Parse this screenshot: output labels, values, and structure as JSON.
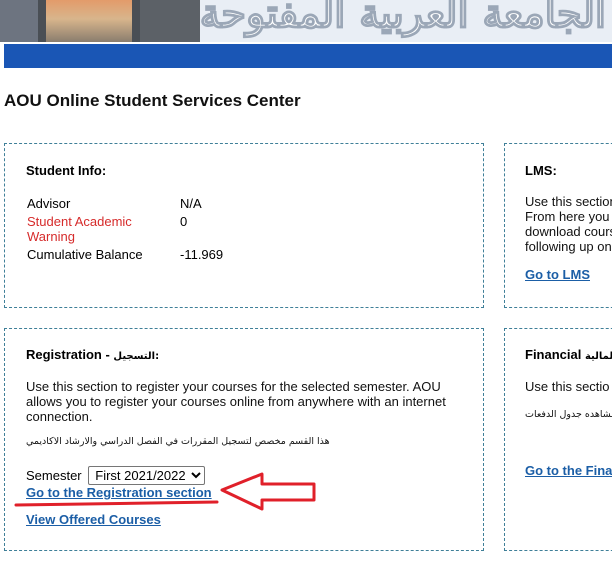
{
  "header": {
    "arabic_title": "الجامعة العربية المفتوحة"
  },
  "page_title": "AOU Online Student Services Center",
  "student_info": {
    "title": "Student Info:",
    "rows": [
      {
        "label": "Advisor",
        "value": "N/A"
      },
      {
        "label": "Student Academic Warning",
        "value": "0"
      },
      {
        "label": "Cumulative Balance",
        "value": "-11.969"
      }
    ]
  },
  "lms": {
    "title": "LMS:",
    "text": "Use this section From here you download cours following up on",
    "link": "Go to LMS"
  },
  "registration": {
    "title": "Registration - ",
    "title_ar": "التسجيل:",
    "text": "Use this section to register your courses for the selected semester. AOU allows you to register your courses online from anywhere with an internet connection.",
    "text_ar": "هذا القسم مخصص لتسجيل المقررات في الفصل الدراسي والارشاد الاكاديمي",
    "semester_label": "Semester",
    "semester_selected": "First 2021/2022",
    "link_registration": "Go to the Registration section",
    "link_offered": "View Offered Courses"
  },
  "financial": {
    "title": "Financial",
    "title_ar": "المالية -",
    "text": "Use this sectio",
    "text_ar": "مشاهده جدول الدفعات",
    "link": "Go to the Fina"
  },
  "colors": {
    "blue_bar": "#1a56b5",
    "link": "#1b5ea6",
    "warning": "#d62b2b",
    "annotation": "#e0202a"
  }
}
